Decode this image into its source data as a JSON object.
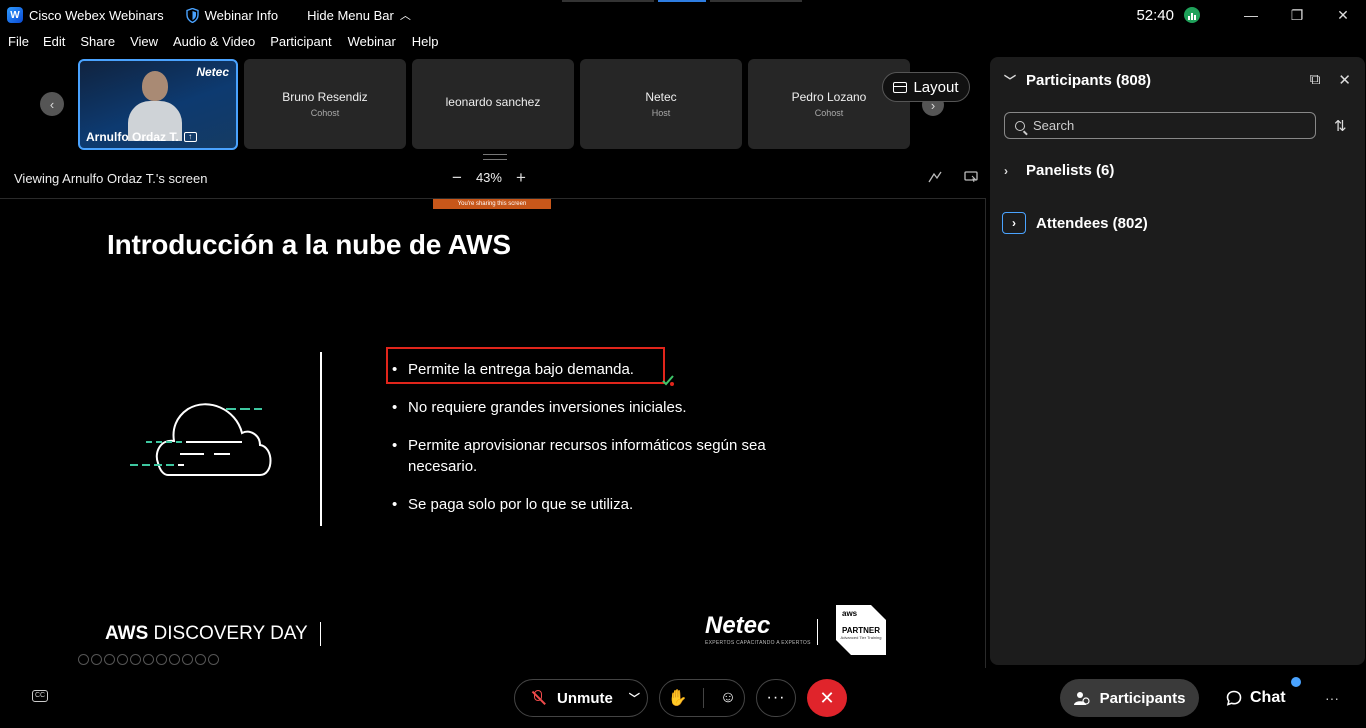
{
  "titlebar": {
    "app_name": "Cisco Webex Webinars",
    "webinar_info": "Webinar Info",
    "hide_menu": "Hide Menu Bar",
    "timer": "52:40",
    "minimize": "—",
    "restore": "❐",
    "close": "✕"
  },
  "menu": [
    "File",
    "Edit",
    "Share",
    "View",
    "Audio & Video",
    "Participant",
    "Webinar",
    "Help"
  ],
  "strip": {
    "prev": "‹",
    "next": "›",
    "layout_label": "Layout",
    "video_tile": {
      "name": "Arnulfo Ordaz T.",
      "brand": "Netec"
    },
    "tiles": [
      {
        "name": "Bruno Resendiz",
        "role": "Cohost"
      },
      {
        "name": "leonardo sanchez",
        "role": ""
      },
      {
        "name": "Netec",
        "role": "Host"
      },
      {
        "name": "Pedro Lozano",
        "role": "Cohost"
      }
    ]
  },
  "viewing": {
    "label": "Viewing Arnulfo Ordaz T.'s screen",
    "zoom_minus": "−",
    "zoom_value": "43%",
    "zoom_plus": "+"
  },
  "slide": {
    "sharing_banner": "You're sharing this screen",
    "title": "Introducción a la nube de AWS",
    "bullets": [
      "Permite la entrega bajo demanda.",
      "No requiere grandes inversiones iniciales.",
      "Permite aprovisionar recursos informáticos según sea necesario.",
      "Se paga solo por lo que se utiliza."
    ],
    "footer_aws_bold": "AWS",
    "footer_aws_rest": " DISCOVERY DAY",
    "netec_logo": "Netec",
    "netec_tagline": "EXPERTOS CAPACITANDO A EXPERTOS",
    "partner_aws": "aws",
    "partner_label": "PARTNER",
    "partner_sub": "Advanced Tier Training"
  },
  "panel": {
    "title": "Participants (808)",
    "search_placeholder": "Search",
    "groups": [
      {
        "label": "Panelists (6)"
      },
      {
        "label": "Attendees (802)"
      }
    ]
  },
  "bottombar": {
    "cc": "CC",
    "unmute": "Unmute",
    "more": "···",
    "participants": "Participants",
    "chat": "Chat",
    "overflow": "···"
  },
  "colors": {
    "accent": "#4aa3ff",
    "end_call": "#e0242b",
    "highlight_box": "#e1251b",
    "sharing_banner": "#c8571a"
  }
}
